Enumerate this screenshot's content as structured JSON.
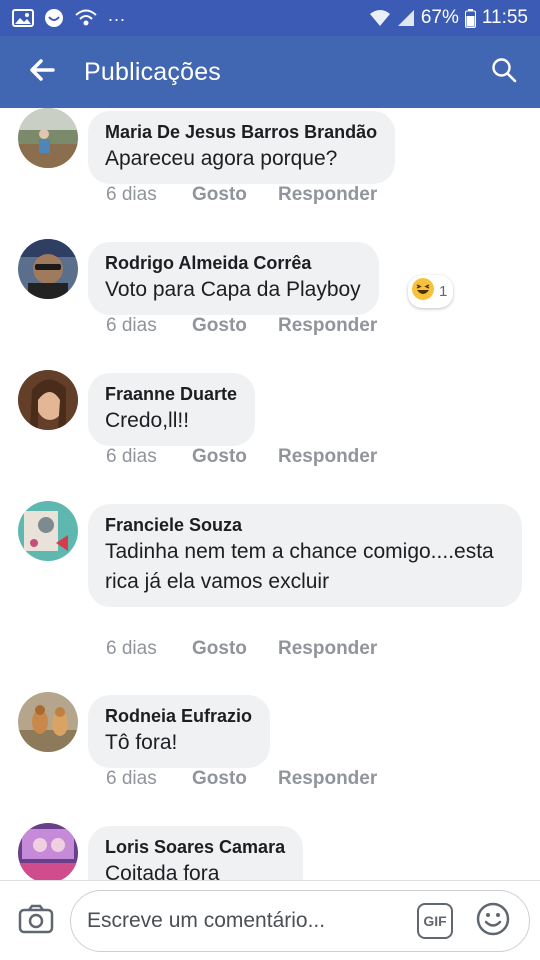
{
  "status_bar": {
    "icons": [
      "image-icon",
      "messenger-icon",
      "wifi-calling-icon"
    ],
    "more": "...",
    "battery_percent": "67%",
    "time": "11:55"
  },
  "header": {
    "title": "Publicações",
    "back_icon": "back-arrow-icon",
    "search_icon": "search-icon"
  },
  "comments": [
    {
      "author": "Maria De Jesus Barros Brandão",
      "text": "Apareceu agora porque?",
      "time": "6 dias",
      "like": "Gosto",
      "reply": "Responder"
    },
    {
      "author": "Rodrigo Almeida Corrêa",
      "text": "Voto para Capa da Playboy",
      "time": "6 dias",
      "like": "Gosto",
      "reply": "Responder",
      "reaction": {
        "icon": "laughing-emoji-icon",
        "count": "1"
      }
    },
    {
      "author": "Fraanne Duarte",
      "text": "Credo,ll!!",
      "time": "6 dias",
      "like": "Gosto",
      "reply": "Responder"
    },
    {
      "author": "Franciele Souza",
      "text": "Tadinha nem tem a chance comigo....esta rica já ela vamos excluir",
      "time": "6 dias",
      "like": "Gosto",
      "reply": "Responder"
    },
    {
      "author": "Rodneia Eufrazio",
      "text": "Tô fora!",
      "time": "6 dias",
      "like": "Gosto",
      "reply": "Responder"
    },
    {
      "author": "Loris Soares Camara",
      "text": "Coitada fora"
    }
  ],
  "composer": {
    "placeholder": "Escreve um comentário...",
    "gif_label": "GIF",
    "camera_icon": "camera-icon",
    "emoji_icon": "emoji-icon"
  },
  "colors": {
    "status_bar": "#3b5bb5",
    "header": "#4267b2",
    "bubble": "#f0f1f3",
    "meta_text": "#90949c"
  }
}
